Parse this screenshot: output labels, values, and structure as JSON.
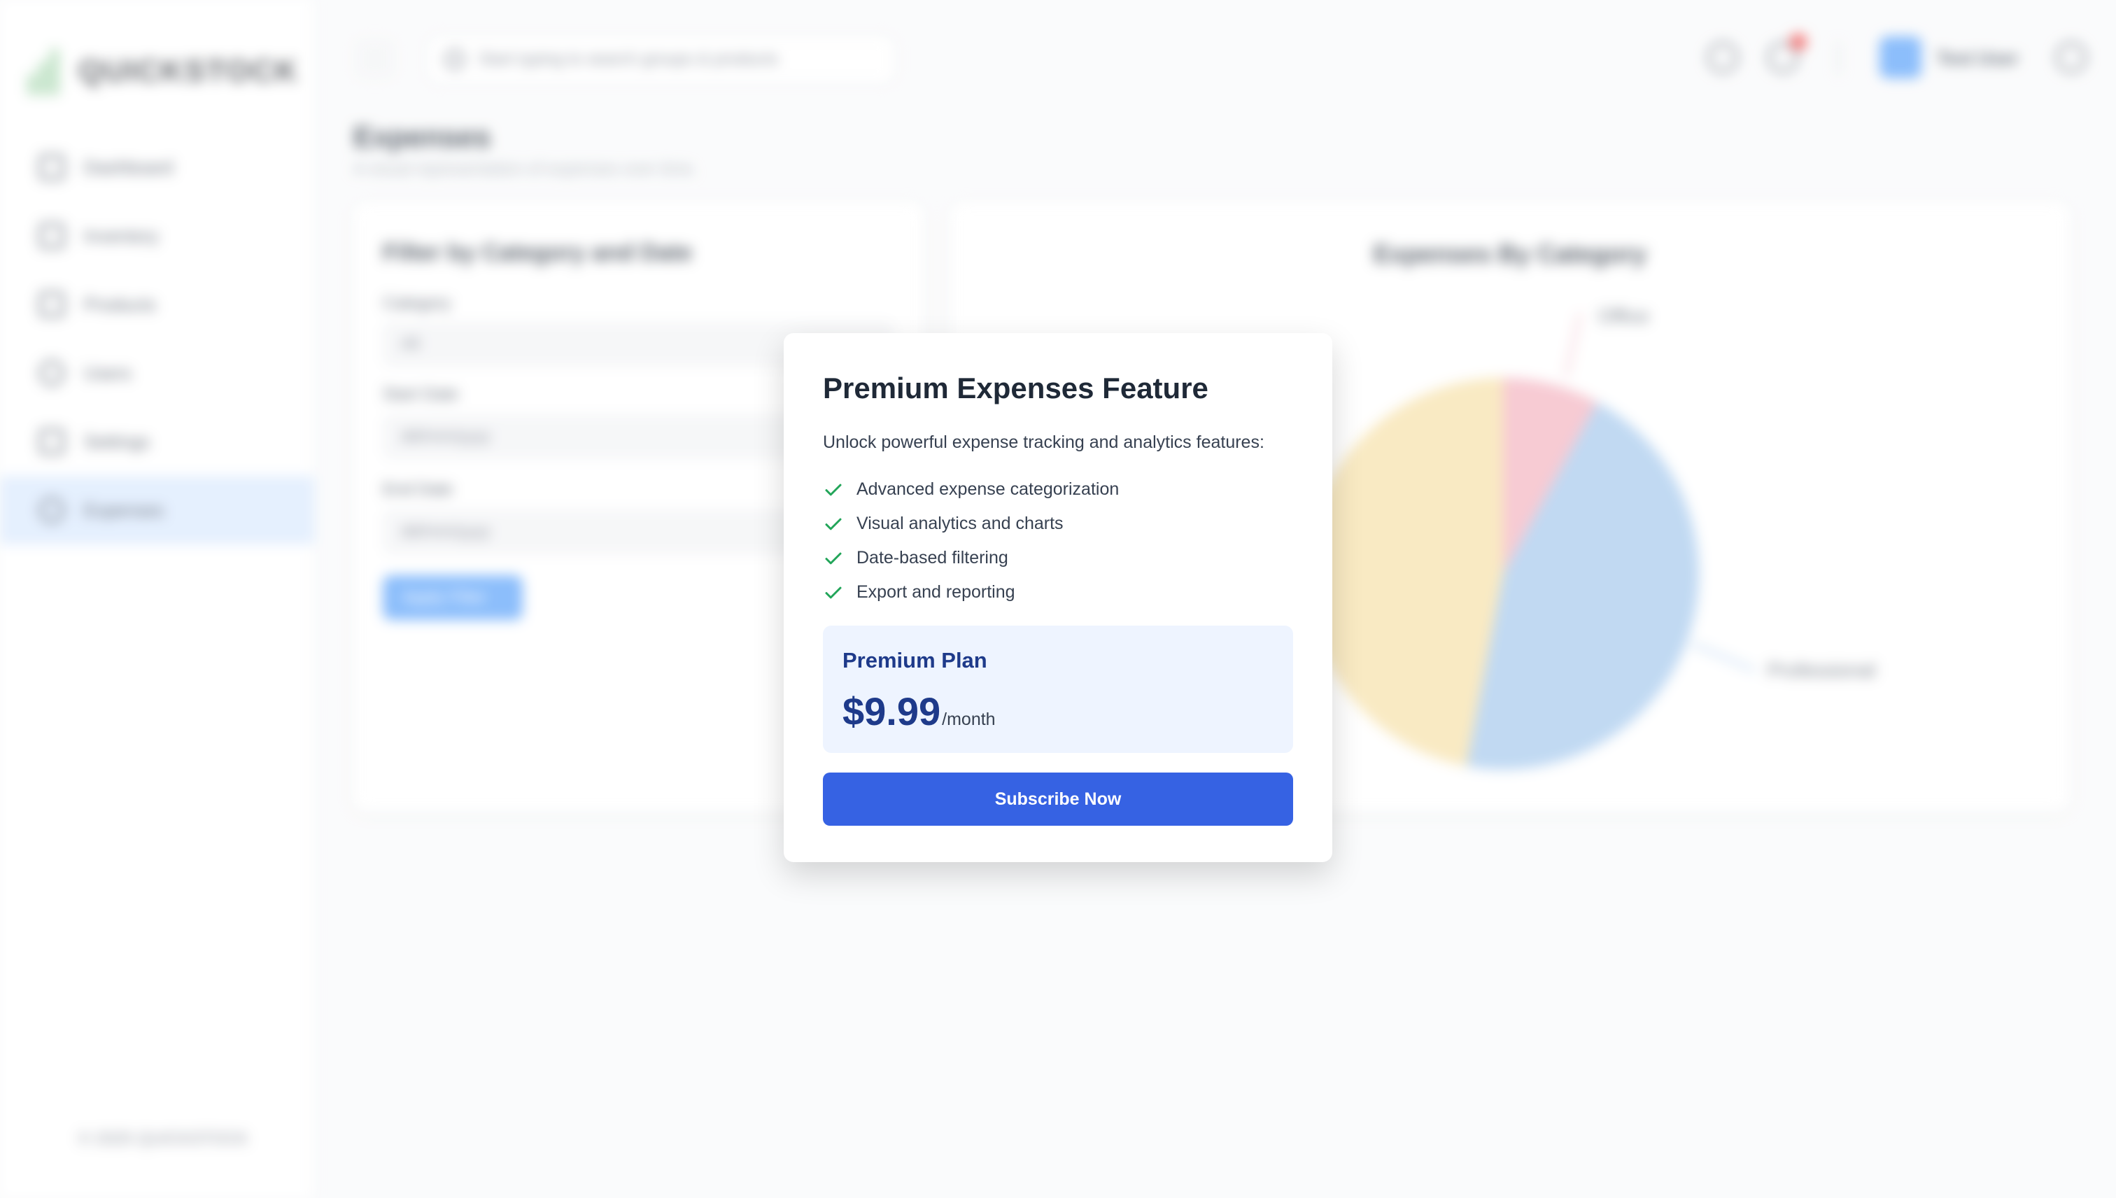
{
  "app": {
    "brand": "QUICKSTOCK",
    "footer": "© 2025 QUICKSTOCK"
  },
  "sidebar": {
    "items": [
      {
        "label": "Dashboard",
        "icon": "dashboard-icon"
      },
      {
        "label": "Inventory",
        "icon": "archive-icon"
      },
      {
        "label": "Products",
        "icon": "clipboard-icon"
      },
      {
        "label": "Users",
        "icon": "user-icon"
      },
      {
        "label": "Settings",
        "icon": "sliders-icon"
      },
      {
        "label": "Expenses",
        "icon": "dollar-icon",
        "active": true
      }
    ]
  },
  "topbar": {
    "search_placeholder": "Start typing to search groups & products",
    "user_name": "Test User"
  },
  "page": {
    "title": "Expenses",
    "subtitle": "A visual representation of expenses over time."
  },
  "filter": {
    "title": "Filter by Category and Date",
    "category_label": "Category",
    "category_value": "All",
    "start_label": "Start Date",
    "start_value": "dd/mm/yyyy",
    "end_label": "End Date",
    "end_value": "dd/mm/yyyy",
    "apply_label": "Apply Filter"
  },
  "chart_data": {
    "type": "pie",
    "title": "Expenses By Category",
    "slices": [
      {
        "label": "Office",
        "value": 8,
        "color": "#f4b7c3"
      },
      {
        "label": "Professional",
        "value": 45,
        "color": "#a9cbee"
      },
      {
        "label": "",
        "value": 47,
        "color": "#f7e2ac"
      }
    ]
  },
  "modal": {
    "title": "Premium Expenses Feature",
    "subtitle": "Unlock powerful expense tracking and analytics features:",
    "features": [
      "Advanced expense categorization",
      "Visual analytics and charts",
      "Date-based filtering",
      "Export and reporting"
    ],
    "plan_name": "Premium Plan",
    "price": "$9.99",
    "period": "/month",
    "cta": "Subscribe Now",
    "accent_color": "#3662e3",
    "check_color": "#22a559"
  }
}
